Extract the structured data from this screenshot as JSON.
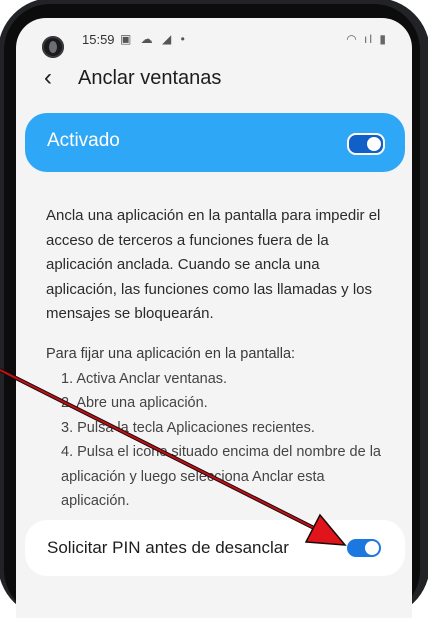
{
  "status_bar": {
    "time": "15:59",
    "left_icons": "▣ ☁ ◢ •",
    "right_icons": "◠ ıl ▮"
  },
  "header": {
    "back_icon": "chevron-left",
    "title": "Anclar ventanas"
  },
  "master_switch": {
    "label": "Activado",
    "state": "on"
  },
  "description": "Ancla una aplicación en la pantalla para impedir el acceso de terceros a funciones fuera de la aplicación anclada. Cuando se ancla una aplicación, las funciones como las llamadas y los mensajes se bloquearán.",
  "instructions": {
    "heading": "Para fijar una aplicación en la pantalla:",
    "steps": [
      "1. Activa Anclar ventanas.",
      "2. Abre una aplicación.",
      "3. Pulsa la tecla Aplicaciones recientes.",
      "4. Pulsa el icono situado encima del nombre de la aplicación y luego selecciona Anclar esta aplicación."
    ]
  },
  "pin_option": {
    "label": "Solicitar PIN antes de desanclar",
    "state": "on"
  },
  "colors": {
    "accent": "#2ea7f6",
    "annotation_arrow": "#e0141b"
  }
}
